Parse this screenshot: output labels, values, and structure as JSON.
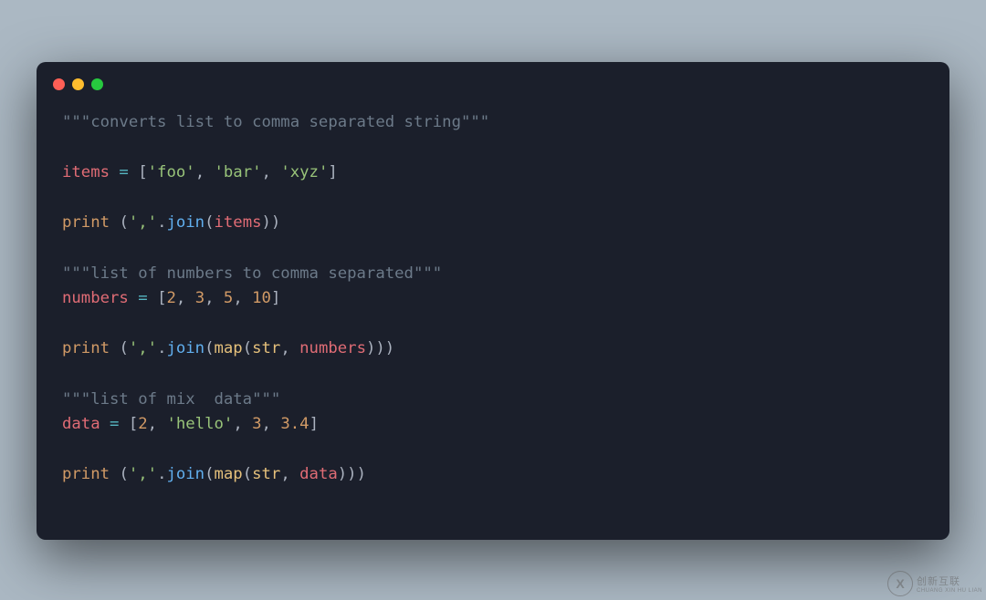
{
  "code": {
    "line1_doc": "\"\"\"converts list to comma separated string\"\"\"",
    "line3_var": "items",
    "line3_eq": " = ",
    "line3_lb": "[",
    "line3_s1": "'foo'",
    "line3_c1": ", ",
    "line3_s2": "'bar'",
    "line3_c2": ", ",
    "line3_s3": "'xyz'",
    "line3_rb": "]",
    "line5_print": "print",
    "line5_sp": " ",
    "line5_lp": "(",
    "line5_str": "','",
    "line5_dot": ".",
    "line5_join": "join",
    "line5_lp2": "(",
    "line5_arg": "items",
    "line5_rp": "))",
    "line7_doc": "\"\"\"list of numbers to comma separated\"\"\"",
    "line8_var": "numbers",
    "line8_eq": " = ",
    "line8_lb": "[",
    "line8_n1": "2",
    "line8_c1": ", ",
    "line8_n2": "3",
    "line8_c2": ", ",
    "line8_n3": "5",
    "line8_c3": ", ",
    "line8_n4": "10",
    "line8_rb": "]",
    "line10_print": "print",
    "line10_sp": " ",
    "line10_lp": "(",
    "line10_str": "','",
    "line10_dot": ".",
    "line10_join": "join",
    "line10_lp2": "(",
    "line10_map": "map",
    "line10_lp3": "(",
    "line10_strfn": "str",
    "line10_c": ", ",
    "line10_arg": "numbers",
    "line10_rp": ")))",
    "line12_doc": "\"\"\"list of mix  data\"\"\"",
    "line13_var": "data",
    "line13_eq": " = ",
    "line13_lb": "[",
    "line13_n1": "2",
    "line13_c1": ", ",
    "line13_s1": "'hello'",
    "line13_c2": ", ",
    "line13_n2": "3",
    "line13_c3": ", ",
    "line13_n3": "3.4",
    "line13_rb": "]",
    "line15_print": "print",
    "line15_sp": " ",
    "line15_lp": "(",
    "line15_str": "','",
    "line15_dot": ".",
    "line15_join": "join",
    "line15_lp2": "(",
    "line15_map": "map",
    "line15_lp3": "(",
    "line15_strfn": "str",
    "line15_c": ", ",
    "line15_arg": "data",
    "line15_rp": ")))"
  },
  "watermark": {
    "logo": "X",
    "text1": "创新互联",
    "text2": "CHUANG XIN HU LIAN"
  }
}
